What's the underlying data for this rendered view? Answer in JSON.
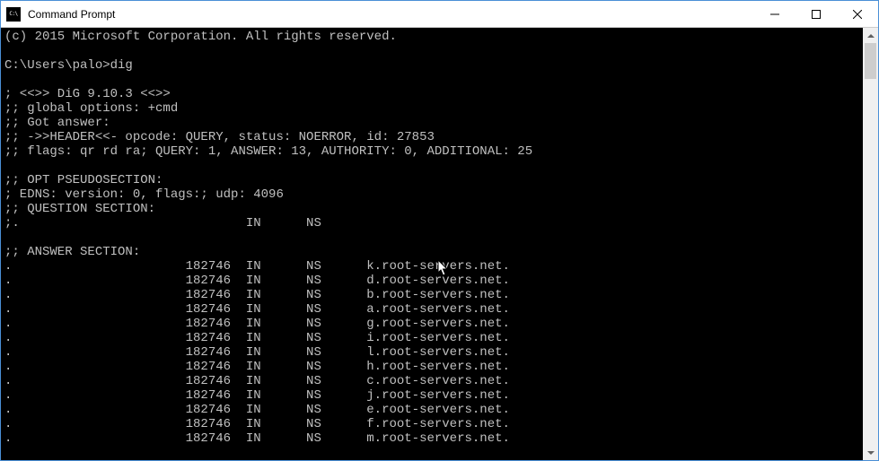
{
  "window": {
    "title": "Command Prompt"
  },
  "terminal": {
    "copyright": "(c) 2015 Microsoft Corporation. All rights reserved.",
    "blank1": "",
    "prompt": "C:\\Users\\palo>dig",
    "blank2": "",
    "dig_version": "; <<>> DiG 9.10.3 <<>>",
    "global_opts": ";; global options: +cmd",
    "got_answer": ";; Got answer:",
    "header": ";; ->>HEADER<<- opcode: QUERY, status: NOERROR, id: 27853",
    "flags": ";; flags: qr rd ra; QUERY: 1, ANSWER: 13, AUTHORITY: 0, ADDITIONAL: 25",
    "blank3": "",
    "opt_header": ";; OPT PSEUDOSECTION:",
    "edns": "; EDNS: version: 0, flags:; udp: 4096",
    "question_header": ";; QUESTION SECTION:",
    "question_row": ";.                              IN      NS",
    "blank4": "",
    "answer_header": ";; ANSWER SECTION:",
    "answers": [
      ".                       182746  IN      NS      k.root-servers.net.",
      ".                       182746  IN      NS      d.root-servers.net.",
      ".                       182746  IN      NS      b.root-servers.net.",
      ".                       182746  IN      NS      a.root-servers.net.",
      ".                       182746  IN      NS      g.root-servers.net.",
      ".                       182746  IN      NS      i.root-servers.net.",
      ".                       182746  IN      NS      l.root-servers.net.",
      ".                       182746  IN      NS      h.root-servers.net.",
      ".                       182746  IN      NS      c.root-servers.net.",
      ".                       182746  IN      NS      j.root-servers.net.",
      ".                       182746  IN      NS      e.root-servers.net.",
      ".                       182746  IN      NS      f.root-servers.net.",
      ".                       182746  IN      NS      m.root-servers.net."
    ]
  }
}
